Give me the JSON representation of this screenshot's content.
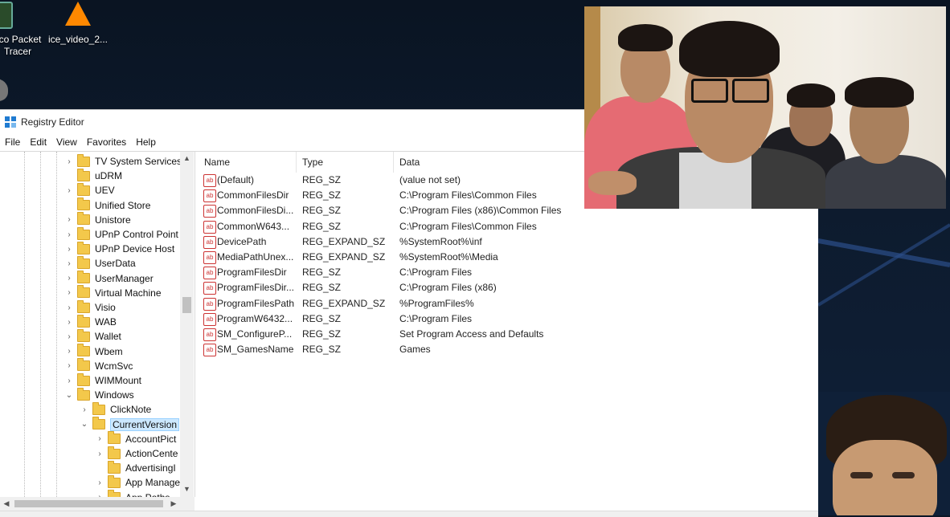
{
  "desktop": {
    "icons": [
      {
        "label_line1": "sco Packet",
        "label_line2": "Tracer",
        "icon": "packet-tracer-icon"
      },
      {
        "label_line1": "ice_video_2...",
        "label_line2": "",
        "icon": "vlc-icon"
      },
      {
        "label_line1": "",
        "label_line2": "",
        "icon": "gimp-icon"
      }
    ]
  },
  "window": {
    "title": "Registry Editor",
    "menu": [
      "File",
      "Edit",
      "View",
      "Favorites",
      "Help"
    ]
  },
  "tree": {
    "items": [
      {
        "label": "TV System Services",
        "expander": ">"
      },
      {
        "label": "uDRM",
        "expander": ""
      },
      {
        "label": "UEV",
        "expander": ">"
      },
      {
        "label": "Unified Store",
        "expander": ""
      },
      {
        "label": "Unistore",
        "expander": ">"
      },
      {
        "label": "UPnP Control Point",
        "expander": ">"
      },
      {
        "label": "UPnP Device Host",
        "expander": ">"
      },
      {
        "label": "UserData",
        "expander": ">"
      },
      {
        "label": "UserManager",
        "expander": ">"
      },
      {
        "label": "Virtual Machine",
        "expander": ">"
      },
      {
        "label": "Visio",
        "expander": ">"
      },
      {
        "label": "WAB",
        "expander": ">"
      },
      {
        "label": "Wallet",
        "expander": ">"
      },
      {
        "label": "Wbem",
        "expander": ">"
      },
      {
        "label": "WcmSvc",
        "expander": ">"
      },
      {
        "label": "WIMMount",
        "expander": ">"
      },
      {
        "label": "Windows",
        "expander": "v"
      },
      {
        "label": "ClickNote",
        "expander": ">"
      },
      {
        "label": "CurrentVersion",
        "expander": "v"
      },
      {
        "label": "AccountPict",
        "expander": ">"
      },
      {
        "label": "ActionCente",
        "expander": ">"
      },
      {
        "label": "AdvertisingI",
        "expander": ""
      },
      {
        "label": "App Manage",
        "expander": ">"
      },
      {
        "label": "App Paths",
        "expander": ">"
      }
    ]
  },
  "values": {
    "columns": [
      "Name",
      "Type",
      "Data"
    ],
    "rows": [
      {
        "name": "(Default)",
        "type": "REG_SZ",
        "data": "(value not set)"
      },
      {
        "name": "CommonFilesDir",
        "type": "REG_SZ",
        "data": "C:\\Program Files\\Common Files"
      },
      {
        "name": "CommonFilesDi...",
        "type": "REG_SZ",
        "data": "C:\\Program Files (x86)\\Common Files"
      },
      {
        "name": "CommonW643...",
        "type": "REG_SZ",
        "data": "C:\\Program Files\\Common Files"
      },
      {
        "name": "DevicePath",
        "type": "REG_EXPAND_SZ",
        "data": "%SystemRoot%\\inf"
      },
      {
        "name": "MediaPathUnex...",
        "type": "REG_EXPAND_SZ",
        "data": "%SystemRoot%\\Media"
      },
      {
        "name": "ProgramFilesDir",
        "type": "REG_SZ",
        "data": "C:\\Program Files"
      },
      {
        "name": "ProgramFilesDir...",
        "type": "REG_SZ",
        "data": "C:\\Program Files (x86)"
      },
      {
        "name": "ProgramFilesPath",
        "type": "REG_EXPAND_SZ",
        "data": "%ProgramFiles%"
      },
      {
        "name": "ProgramW6432...",
        "type": "REG_SZ",
        "data": "C:\\Program Files"
      },
      {
        "name": "SM_ConfigureP...",
        "type": "REG_SZ",
        "data": "Set Program Access and Defaults"
      },
      {
        "name": "SM_GamesName",
        "type": "REG_SZ",
        "data": "Games"
      }
    ],
    "value_icon_text": "ab"
  }
}
